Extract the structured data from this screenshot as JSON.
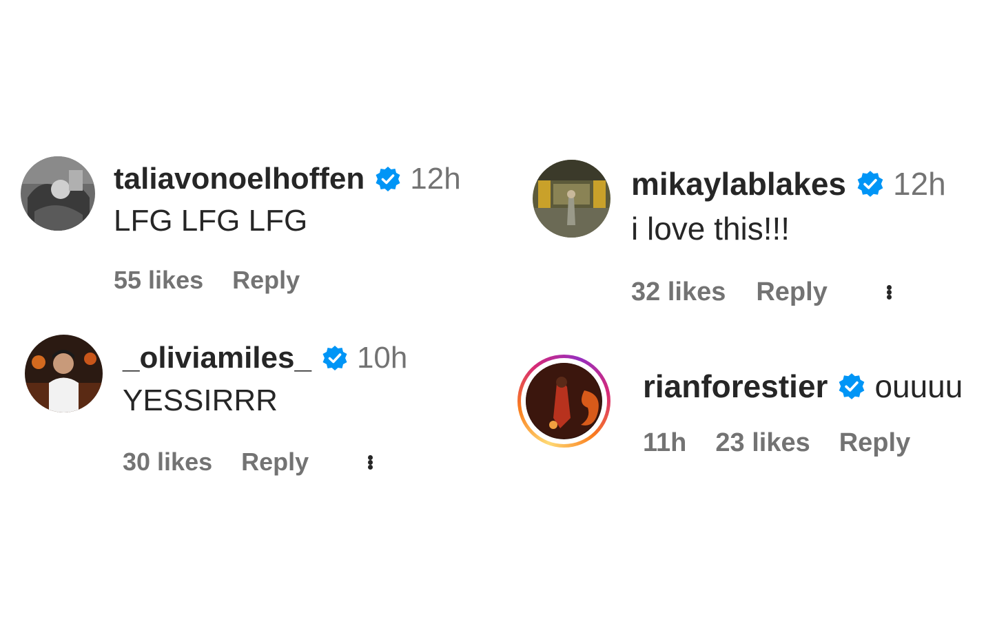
{
  "colors": {
    "verified_blue": "#0095f6",
    "text_primary": "#262626",
    "text_secondary": "#737373"
  },
  "comments": [
    {
      "username": "taliavonoelhoffen",
      "verified_icon": "verified-badge-icon",
      "time": "12h",
      "text": "LFG LFG LFG",
      "likes": "55 likes",
      "reply": "Reply"
    },
    {
      "username": "_oliviamiles_",
      "verified_icon": "verified-badge-icon",
      "time": "10h",
      "text": "YESSIRRR",
      "likes": "30 likes",
      "reply": "Reply",
      "more_icon": "more-options-icon"
    },
    {
      "username": "mikaylablakes",
      "verified_icon": "verified-badge-icon",
      "time": "12h",
      "text": "i love this!!!",
      "likes": "32 likes",
      "reply": "Reply",
      "more_icon": "more-options-icon"
    },
    {
      "username": "rianforestier",
      "verified_icon": "verified-badge-icon",
      "text": "ouuuu",
      "time": "11h",
      "likes": "23 likes",
      "reply": "Reply",
      "story_ring": true
    }
  ]
}
